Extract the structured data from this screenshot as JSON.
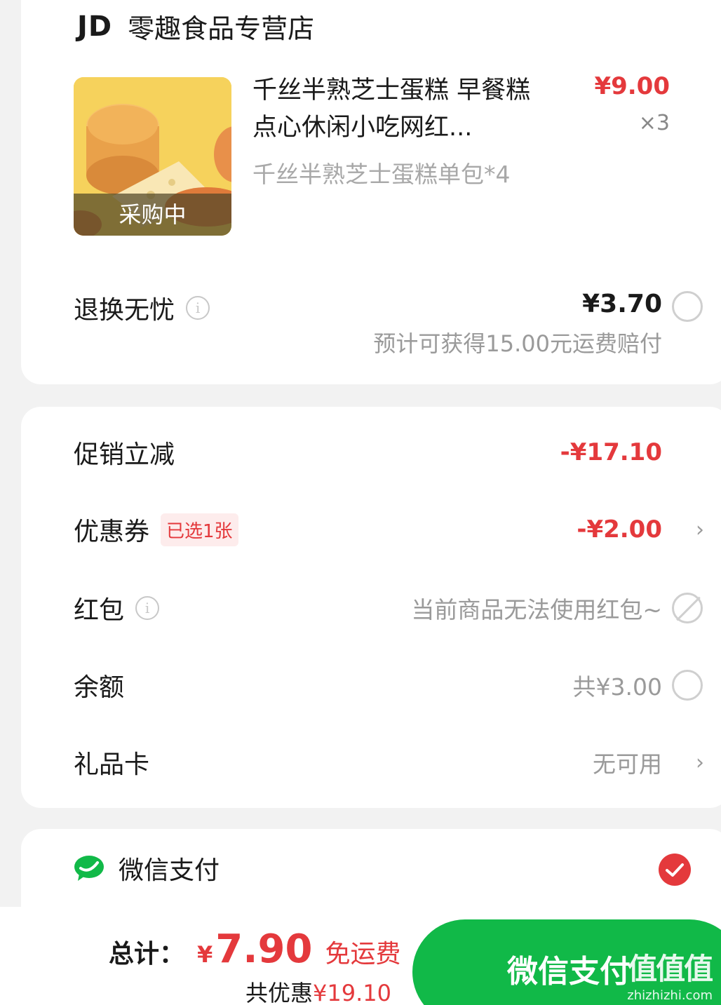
{
  "store": {
    "logo": "JD",
    "name": "零趣食品专营店"
  },
  "product": {
    "tag": "采购中",
    "title": "千丝半熟芝士蛋糕 早餐糕点心休闲小吃网红...",
    "spec": "千丝半熟芝士蛋糕单包*4",
    "price": "¥9.00",
    "qty": "×3"
  },
  "service": {
    "label": "退换无忧",
    "price": "¥3.70",
    "sub": "预计可获得15.00元运费赔付"
  },
  "discounts": {
    "promo_label": "促销立减",
    "promo_value": "-¥17.10",
    "coupon_label": "优惠券",
    "coupon_tag": "已选1张",
    "coupon_value": "-¥2.00",
    "redpacket_label": "红包",
    "redpacket_value": "当前商品无法使用红包~",
    "balance_label": "余额",
    "balance_value": "共¥3.00",
    "giftcard_label": "礼品卡",
    "giftcard_value": "无可用"
  },
  "payment": {
    "method": "微信支付"
  },
  "bottom": {
    "total_label": "总计：",
    "yen": "¥",
    "amount": "7.90",
    "shipping": "免运费",
    "saved_prefix": "共优惠",
    "saved_amount": "¥19.10",
    "pay_button": "微信支付"
  },
  "watermark": {
    "big": "值值值",
    "small": "zhizhizhi.com"
  },
  "colors": {
    "accent_red": "#e4393c",
    "wechat_green": "#11b948"
  }
}
